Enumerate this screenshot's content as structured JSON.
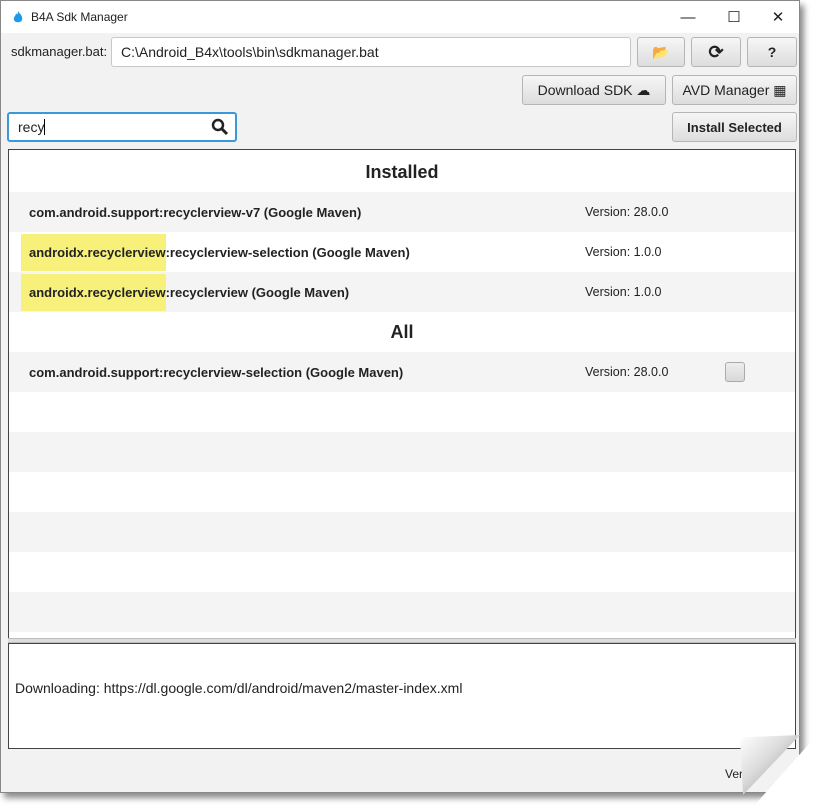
{
  "window": {
    "title": "B4A Sdk Manager"
  },
  "toolbar": {
    "sdk_label": "sdkmanager.bat:",
    "sdk_path": "C:\\Android_B4x\\tools\\bin\\sdkmanager.bat",
    "help_label": "?",
    "download_sdk_label": "Download SDK",
    "avd_manager_label": "AVD Manager",
    "install_selected_label": "Install Selected"
  },
  "search": {
    "value": "recy"
  },
  "sections": [
    {
      "title": "Installed",
      "items": [
        {
          "highlight": "",
          "name": "com.android.support:recyclerview-v7 (Google Maven)",
          "version": "Version: 28.0.0"
        },
        {
          "highlight": "androidx.recyclerview",
          "name": ":recyclerview-selection (Google Maven)",
          "version": "Version: 1.0.0"
        },
        {
          "highlight": "androidx.recyclerview",
          "name": ":recyclerview (Google Maven)",
          "version": "Version: 1.0.0"
        }
      ]
    },
    {
      "title": "All",
      "items": [
        {
          "highlight": "",
          "name": "com.android.support:recyclerview-selection (Google Maven)",
          "version": "Version: 28.0.0",
          "checked": false
        }
      ]
    }
  ],
  "log": {
    "text": "Downloading: https://dl.google.com/dl/android/maven2/master-index.xml"
  },
  "status": {
    "text": "Versi"
  }
}
